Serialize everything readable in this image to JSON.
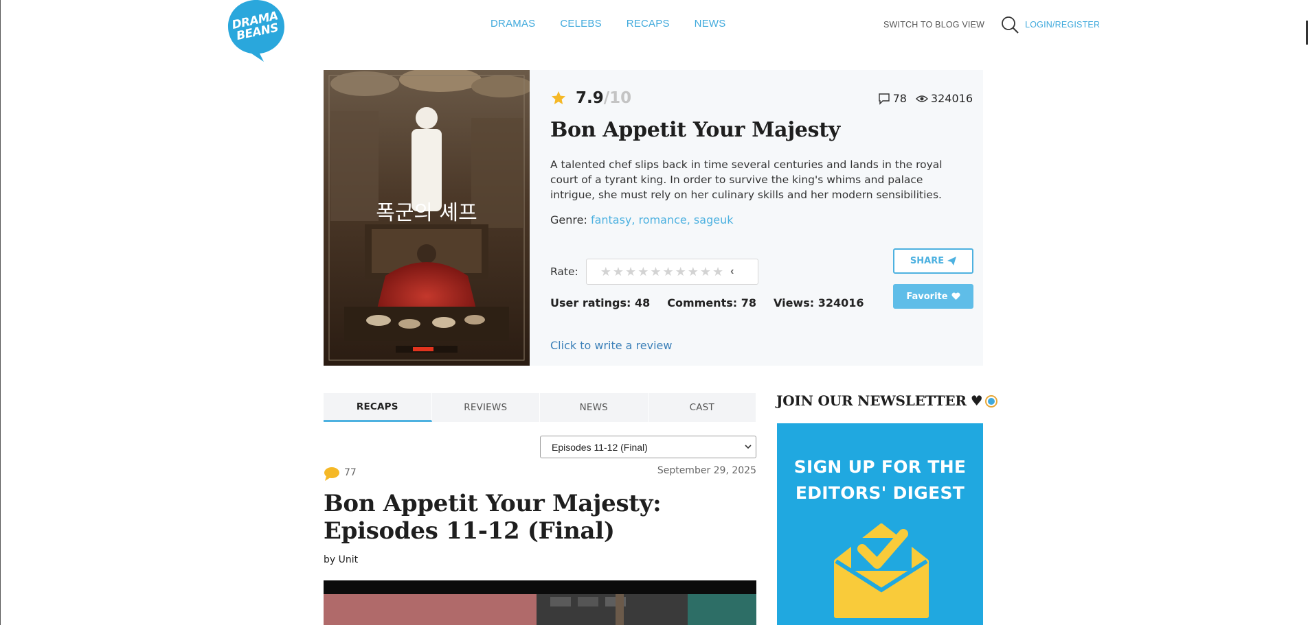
{
  "header": {
    "logo_line1": "DRAMA",
    "logo_line2": "BEANS",
    "nav": [
      "DRAMAS",
      "CELEBS",
      "RECAPS",
      "NEWS"
    ],
    "switch_view": "SWITCH TO BLOG VIEW",
    "login": "LOGIN/REGISTER"
  },
  "drama": {
    "score": "7.9",
    "score_max": "/10",
    "comments_count": "78",
    "views_count": "324016",
    "title": "Bon Appetit Your Majesty",
    "synopsis": "A talented chef slips back in time several centuries and lands in the royal court of a tyrant king. In order to survive the king's whims and palace intrigue, she must rely on her culinary skills and her modern sensibilities.",
    "genre_label": "Genre:",
    "genres": "fantasy, romance, sageuk",
    "rate_label": "Rate:",
    "rate_stars": 10,
    "user_ratings": "User ratings: 48",
    "comments": "Comments: 78",
    "views": "Views: 324016",
    "share_label": "SHARE",
    "favorite_label": "Favorite",
    "review_link": "Click to write a review",
    "accent_color": "#4db1e0"
  },
  "tabs": [
    "RECAPS",
    "REVIEWS",
    "NEWS",
    "CAST"
  ],
  "active_tab": "RECAPS",
  "episode_select": {
    "selected": "Episodes 11-12 (Final)"
  },
  "post": {
    "comment_count": "77",
    "date": "September 29, 2025",
    "title": "Bon Appetit Your Majesty: Episodes 11-12 (Final)",
    "byline_prefix": "by",
    "author": "Unit"
  },
  "sidebar": {
    "newsletter_heading": "JOIN OUR NEWSLETTER",
    "banner_line1": "SIGN UP FOR THE",
    "banner_line2": "EDITORS' DIGEST"
  },
  "icons": {
    "search": "search-icon",
    "star": "star-icon",
    "comment": "comment-icon",
    "eye": "eye-icon",
    "envelope": "envelope-check-icon"
  }
}
